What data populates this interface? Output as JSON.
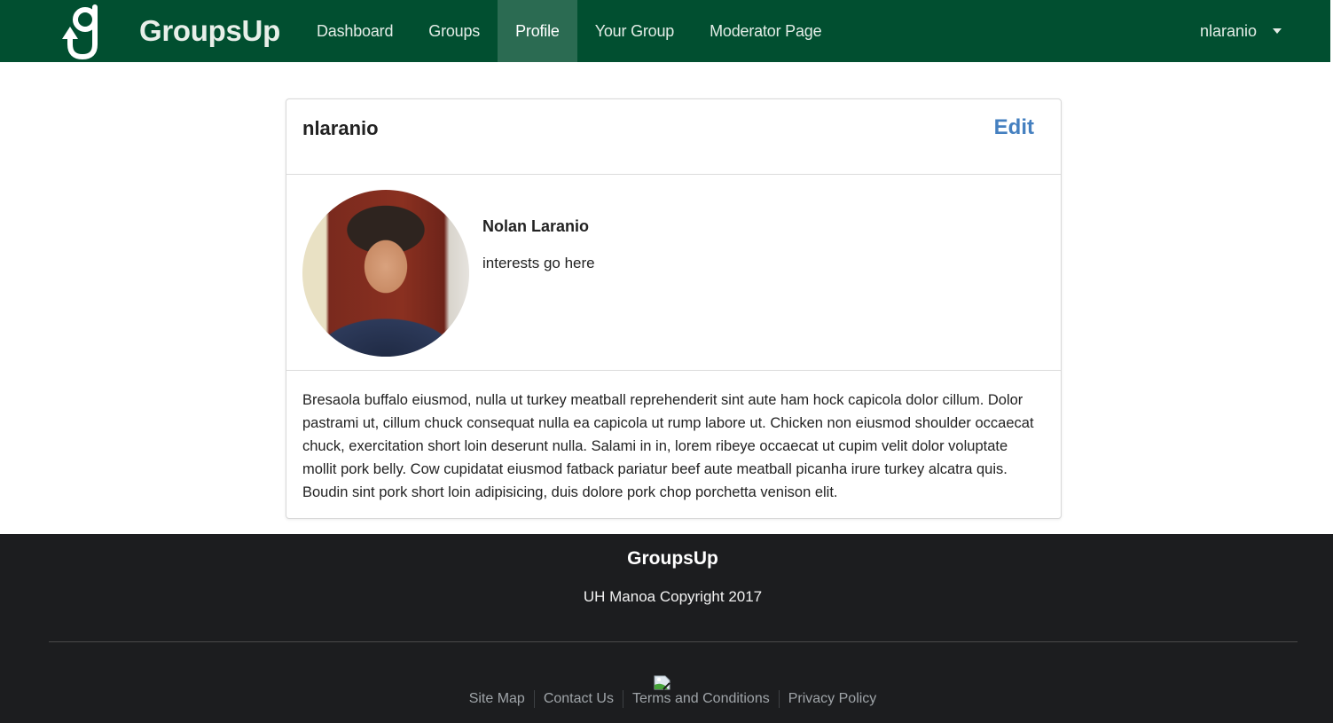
{
  "navbar": {
    "brand": "GroupsUp",
    "logo_icon": "groupsup-g-arrow-logo",
    "items": [
      {
        "label": "Dashboard",
        "active": false
      },
      {
        "label": "Groups",
        "active": false
      },
      {
        "label": "Profile",
        "active": true
      },
      {
        "label": "Your Group",
        "active": false
      },
      {
        "label": "Moderator Page",
        "active": false
      }
    ],
    "user": {
      "label": "nlaranio",
      "icon": "caret-down-icon"
    },
    "colors": {
      "background": "#014f30",
      "active": "#2b6b52"
    }
  },
  "profile": {
    "username": "nlaranio",
    "edit_label": "Edit",
    "edit_color": "#4580c0",
    "full_name": "Nolan Laranio",
    "interests": "interests go here",
    "avatar_alt": "profile photo",
    "bio": "Bresaola buffalo eiusmod, nulla ut turkey meatball reprehenderit sint aute ham hock capicola dolor cillum. Dolor pastrami ut, cillum chuck consequat nulla ea capicola ut rump labore ut. Chicken non eiusmod shoulder occaecat chuck, exercitation short loin deserunt nulla. Salami in in, lorem ribeye occaecat ut cupim velit dolor voluptate mollit pork belly. Cow cupidatat eiusmod fatback pariatur beef aute meatball picanha irure turkey alcatra quis. Boudin sint pork short loin adipisicing, duis dolore pork chop porchetta venison elit."
  },
  "footer": {
    "title": "GroupsUp",
    "copyright": "UH Manoa Copyright 2017",
    "broken_image_icon": "broken-image-icon",
    "links": [
      "Site Map",
      "Contact Us",
      "Terms and Conditions",
      "Privacy Policy"
    ],
    "background": "#1c1d1f"
  }
}
